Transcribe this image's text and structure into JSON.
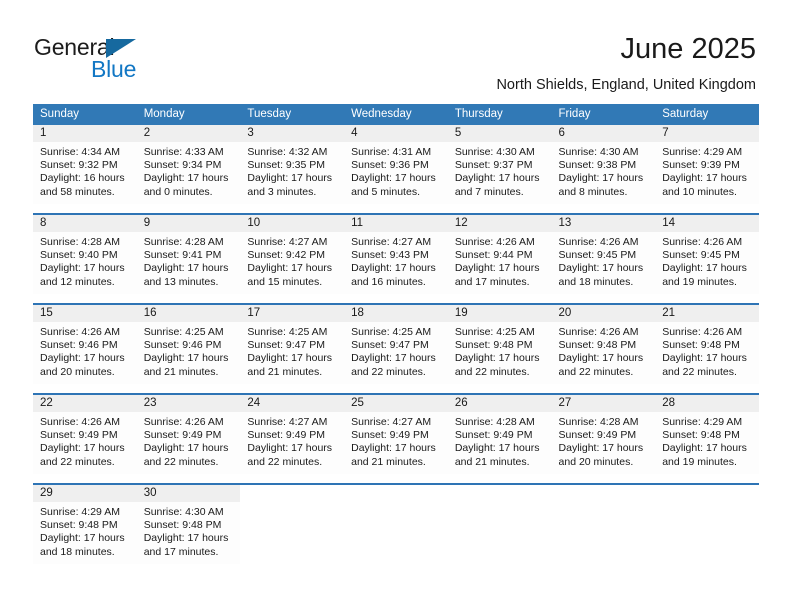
{
  "brand": {
    "name_part1": "General",
    "name_part2": "Blue",
    "logo_icon": "triangle-logo-icon",
    "accent_color": "#1277c4"
  },
  "header": {
    "title": "June 2025",
    "location": "North Shields, England, United Kingdom"
  },
  "calendar": {
    "header_color": "#3179b6",
    "daynum_band_color": "#efefef",
    "week_rule_color": "#2e74b5",
    "weekdays": [
      "Sunday",
      "Monday",
      "Tuesday",
      "Wednesday",
      "Thursday",
      "Friday",
      "Saturday"
    ],
    "weeks": [
      [
        {
          "day": "1",
          "sunrise": "Sunrise: 4:34 AM",
          "sunset": "Sunset: 9:32 PM",
          "daylight": "Daylight: 16 hours and 58 minutes."
        },
        {
          "day": "2",
          "sunrise": "Sunrise: 4:33 AM",
          "sunset": "Sunset: 9:34 PM",
          "daylight": "Daylight: 17 hours and 0 minutes."
        },
        {
          "day": "3",
          "sunrise": "Sunrise: 4:32 AM",
          "sunset": "Sunset: 9:35 PM",
          "daylight": "Daylight: 17 hours and 3 minutes."
        },
        {
          "day": "4",
          "sunrise": "Sunrise: 4:31 AM",
          "sunset": "Sunset: 9:36 PM",
          "daylight": "Daylight: 17 hours and 5 minutes."
        },
        {
          "day": "5",
          "sunrise": "Sunrise: 4:30 AM",
          "sunset": "Sunset: 9:37 PM",
          "daylight": "Daylight: 17 hours and 7 minutes."
        },
        {
          "day": "6",
          "sunrise": "Sunrise: 4:30 AM",
          "sunset": "Sunset: 9:38 PM",
          "daylight": "Daylight: 17 hours and 8 minutes."
        },
        {
          "day": "7",
          "sunrise": "Sunrise: 4:29 AM",
          "sunset": "Sunset: 9:39 PM",
          "daylight": "Daylight: 17 hours and 10 minutes."
        }
      ],
      [
        {
          "day": "8",
          "sunrise": "Sunrise: 4:28 AM",
          "sunset": "Sunset: 9:40 PM",
          "daylight": "Daylight: 17 hours and 12 minutes."
        },
        {
          "day": "9",
          "sunrise": "Sunrise: 4:28 AM",
          "sunset": "Sunset: 9:41 PM",
          "daylight": "Daylight: 17 hours and 13 minutes."
        },
        {
          "day": "10",
          "sunrise": "Sunrise: 4:27 AM",
          "sunset": "Sunset: 9:42 PM",
          "daylight": "Daylight: 17 hours and 15 minutes."
        },
        {
          "day": "11",
          "sunrise": "Sunrise: 4:27 AM",
          "sunset": "Sunset: 9:43 PM",
          "daylight": "Daylight: 17 hours and 16 minutes."
        },
        {
          "day": "12",
          "sunrise": "Sunrise: 4:26 AM",
          "sunset": "Sunset: 9:44 PM",
          "daylight": "Daylight: 17 hours and 17 minutes."
        },
        {
          "day": "13",
          "sunrise": "Sunrise: 4:26 AM",
          "sunset": "Sunset: 9:45 PM",
          "daylight": "Daylight: 17 hours and 18 minutes."
        },
        {
          "day": "14",
          "sunrise": "Sunrise: 4:26 AM",
          "sunset": "Sunset: 9:45 PM",
          "daylight": "Daylight: 17 hours and 19 minutes."
        }
      ],
      [
        {
          "day": "15",
          "sunrise": "Sunrise: 4:26 AM",
          "sunset": "Sunset: 9:46 PM",
          "daylight": "Daylight: 17 hours and 20 minutes."
        },
        {
          "day": "16",
          "sunrise": "Sunrise: 4:25 AM",
          "sunset": "Sunset: 9:46 PM",
          "daylight": "Daylight: 17 hours and 21 minutes."
        },
        {
          "day": "17",
          "sunrise": "Sunrise: 4:25 AM",
          "sunset": "Sunset: 9:47 PM",
          "daylight": "Daylight: 17 hours and 21 minutes."
        },
        {
          "day": "18",
          "sunrise": "Sunrise: 4:25 AM",
          "sunset": "Sunset: 9:47 PM",
          "daylight": "Daylight: 17 hours and 22 minutes."
        },
        {
          "day": "19",
          "sunrise": "Sunrise: 4:25 AM",
          "sunset": "Sunset: 9:48 PM",
          "daylight": "Daylight: 17 hours and 22 minutes."
        },
        {
          "day": "20",
          "sunrise": "Sunrise: 4:26 AM",
          "sunset": "Sunset: 9:48 PM",
          "daylight": "Daylight: 17 hours and 22 minutes."
        },
        {
          "day": "21",
          "sunrise": "Sunrise: 4:26 AM",
          "sunset": "Sunset: 9:48 PM",
          "daylight": "Daylight: 17 hours and 22 minutes."
        }
      ],
      [
        {
          "day": "22",
          "sunrise": "Sunrise: 4:26 AM",
          "sunset": "Sunset: 9:49 PM",
          "daylight": "Daylight: 17 hours and 22 minutes."
        },
        {
          "day": "23",
          "sunrise": "Sunrise: 4:26 AM",
          "sunset": "Sunset: 9:49 PM",
          "daylight": "Daylight: 17 hours and 22 minutes."
        },
        {
          "day": "24",
          "sunrise": "Sunrise: 4:27 AM",
          "sunset": "Sunset: 9:49 PM",
          "daylight": "Daylight: 17 hours and 22 minutes."
        },
        {
          "day": "25",
          "sunrise": "Sunrise: 4:27 AM",
          "sunset": "Sunset: 9:49 PM",
          "daylight": "Daylight: 17 hours and 21 minutes."
        },
        {
          "day": "26",
          "sunrise": "Sunrise: 4:28 AM",
          "sunset": "Sunset: 9:49 PM",
          "daylight": "Daylight: 17 hours and 21 minutes."
        },
        {
          "day": "27",
          "sunrise": "Sunrise: 4:28 AM",
          "sunset": "Sunset: 9:49 PM",
          "daylight": "Daylight: 17 hours and 20 minutes."
        },
        {
          "day": "28",
          "sunrise": "Sunrise: 4:29 AM",
          "sunset": "Sunset: 9:48 PM",
          "daylight": "Daylight: 17 hours and 19 minutes."
        }
      ],
      [
        {
          "day": "29",
          "sunrise": "Sunrise: 4:29 AM",
          "sunset": "Sunset: 9:48 PM",
          "daylight": "Daylight: 17 hours and 18 minutes."
        },
        {
          "day": "30",
          "sunrise": "Sunrise: 4:30 AM",
          "sunset": "Sunset: 9:48 PM",
          "daylight": "Daylight: 17 hours and 17 minutes."
        },
        {
          "day": "",
          "sunrise": "",
          "sunset": "",
          "daylight": ""
        },
        {
          "day": "",
          "sunrise": "",
          "sunset": "",
          "daylight": ""
        },
        {
          "day": "",
          "sunrise": "",
          "sunset": "",
          "daylight": ""
        },
        {
          "day": "",
          "sunrise": "",
          "sunset": "",
          "daylight": ""
        },
        {
          "day": "",
          "sunrise": "",
          "sunset": "",
          "daylight": ""
        }
      ]
    ]
  }
}
